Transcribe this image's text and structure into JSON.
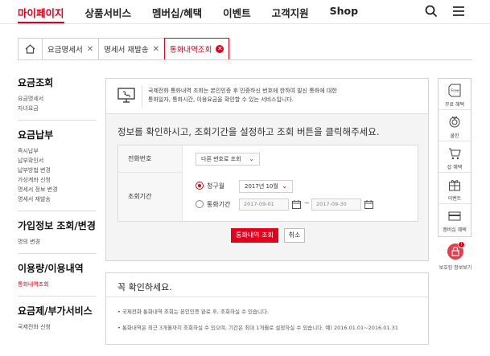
{
  "topnav": {
    "items": [
      "마이페이지",
      "상품서비스",
      "멤버십/혜택",
      "이벤트",
      "고객지원",
      "Shop"
    ]
  },
  "tabs": [
    {
      "label": "요금명세서"
    },
    {
      "label": "명세서 재발송"
    },
    {
      "label": "통화내역조회"
    }
  ],
  "sidebar": {
    "groups": [
      {
        "title": "요금조회",
        "items": [
          "요금명세서",
          "자녀요금"
        ]
      },
      {
        "title": "요금납부",
        "items": [
          "즉시납부",
          "납부확인서",
          "납부방법 변경",
          "가상계좌 신청",
          "명세서 정보 변경",
          "명세서 재발송"
        ]
      },
      {
        "title": "가입정보 조회/변경",
        "items": [
          "명의 변경"
        ]
      },
      {
        "title": "이용량/이용내역",
        "items": [
          "통화내역조회"
        ]
      },
      {
        "title": "요금제/부가서비스",
        "items": [
          "국제전화 신청"
        ]
      }
    ]
  },
  "intro": {
    "line1": "국제전화 통화내역 조회는 본인인증 후 인증하신 번호에 한하여 발신 통화에 대한",
    "line2": "통화일자, 통화시간, 이용요금을 확인할 수 있는 서비스입니다."
  },
  "guide": "정보를 확인하시고, 조회기간을 설정하고 조회 버튼을 클릭해주세요.",
  "form": {
    "phone_label": "전화번호",
    "phone_select": "다른 번호로 조회",
    "period_label": "조회기간",
    "opt1": "청구월",
    "month_select": "2017년 10월",
    "opt2": "통화기간",
    "date_from": "2017-09-01",
    "tilde": "~",
    "date_to": "2017-09-30",
    "search_btn": "통화내역 조회",
    "cancel_btn": "취소"
  },
  "notice": {
    "title": "꼭 확인하세요.",
    "line1": "•  국제전화 통화내역 조회는 본인인증 완료 후, 조회하실 수 있습니다.",
    "line2": "•  통화내역은 최근 3개월까지 조회하실 수 있으며, 기간은 최대 1개월로 설정하실 수 있습니다. 예) 2016.01.01~2016.01.31"
  },
  "quick": {
    "items": [
      "무료 혜택",
      "쿨한",
      "샵 혜택",
      "이벤트",
      "멤버십 혜택"
    ],
    "free_badge": "Free",
    "lock_label": "보호된 정보보기",
    "lock_badge": "!"
  },
  "colors": {
    "accent": "#e2001a"
  }
}
